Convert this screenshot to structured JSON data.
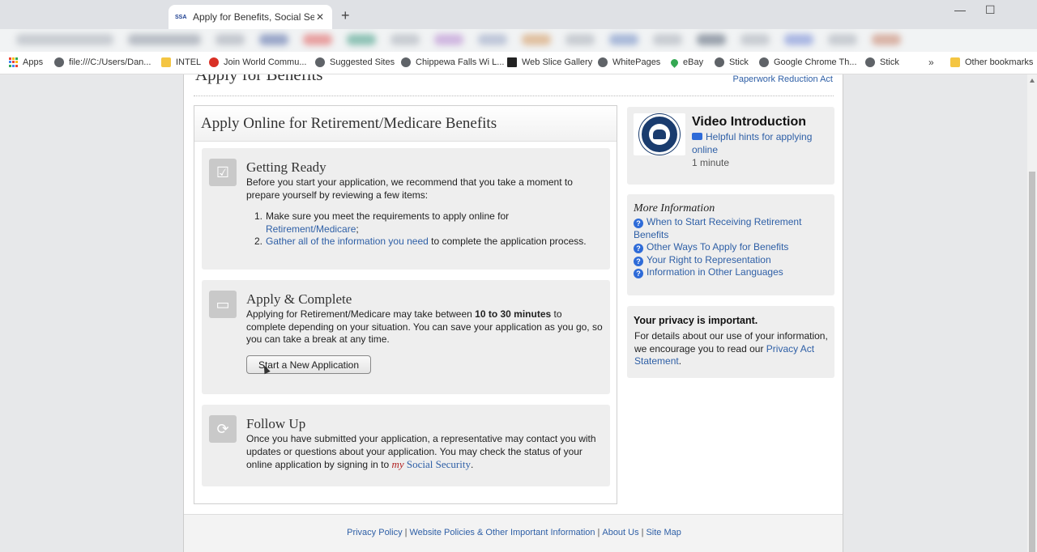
{
  "browser": {
    "tab_title": "Apply for Benefits, Social Security",
    "tab_favicon": "SSA",
    "new_tab": "+",
    "close_tab": "✕",
    "minimize": "—",
    "maximize": "☐",
    "bookmarks": [
      {
        "label": "Apps",
        "icon": "apps-icon"
      },
      {
        "label": "file:///C:/Users/Dan...",
        "icon": "globe-icon"
      },
      {
        "label": "INTEL",
        "icon": "folder-icon"
      },
      {
        "label": "Join World Commu...",
        "icon": "red-globe-icon"
      },
      {
        "label": "Suggested Sites",
        "icon": "globe-icon"
      },
      {
        "label": "Chippewa Falls Wi L...",
        "icon": "globe-icon"
      },
      {
        "label": "Web Slice Gallery",
        "icon": "web-slice-icon"
      },
      {
        "label": "WhitePages",
        "icon": "globe-icon"
      },
      {
        "label": "eBay",
        "icon": "pin-icon"
      },
      {
        "label": "Stick",
        "icon": "globe-icon"
      },
      {
        "label": "Google Chrome Th...",
        "icon": "globe-icon"
      },
      {
        "label": "Stick",
        "icon": "globe-icon"
      }
    ],
    "more_bookmarks": "»",
    "other_bookmarks": "Other bookmarks"
  },
  "page": {
    "heading": "Apply for Benefits",
    "paperwork_link": "Paperwork Reduction Act",
    "main_title": "Apply Online for Retirement/Medicare Benefits",
    "getting_ready": {
      "title": "Getting Ready",
      "text": "Before you start your application, we recommend that you take a moment to prepare yourself by reviewing a few items:",
      "item1_num": "1.",
      "item1_text": "Make sure you meet the requirements to apply online for",
      "item1_link": "Retirement/Medicare",
      "item1_end": ";",
      "item2_num": "2.",
      "item2_link": "Gather all of the information you need",
      "item2_text": " to complete the application process."
    },
    "apply_complete": {
      "title": "Apply & Complete",
      "text_pre": "Applying for Retirement/Medicare may take between ",
      "text_bold": "10 to 30 minutes",
      "text_post": " to complete depending on your situation. You can save your application as you go, so you can take a break at any time.",
      "button": "Start a New Application"
    },
    "follow_up": {
      "title": "Follow Up",
      "text": "Once you have submitted your application, a representative may contact you with updates or questions about your application. You may check the status of your online application by signing in to ",
      "my": "my",
      "ss": " Social Security",
      "end": "."
    },
    "video": {
      "title": "Video Introduction",
      "link": "Helpful hints for applying online",
      "duration": "1 minute"
    },
    "more_info": {
      "title": "More Information",
      "links": [
        "When to Start Receiving Retirement Benefits",
        "Other Ways To Apply for Benefits",
        "Your Right to Representation",
        "Information in Other Languages"
      ]
    },
    "privacy": {
      "title": "Your privacy is important.",
      "text": "For details about our use of your information, we encourage you to read our ",
      "link": "Privacy Act Statement",
      "end": "."
    },
    "footer": {
      "links": [
        "Privacy Policy",
        "Website Policies & Other Important Information",
        "About Us",
        "Site Map"
      ],
      "separator": "|"
    }
  }
}
